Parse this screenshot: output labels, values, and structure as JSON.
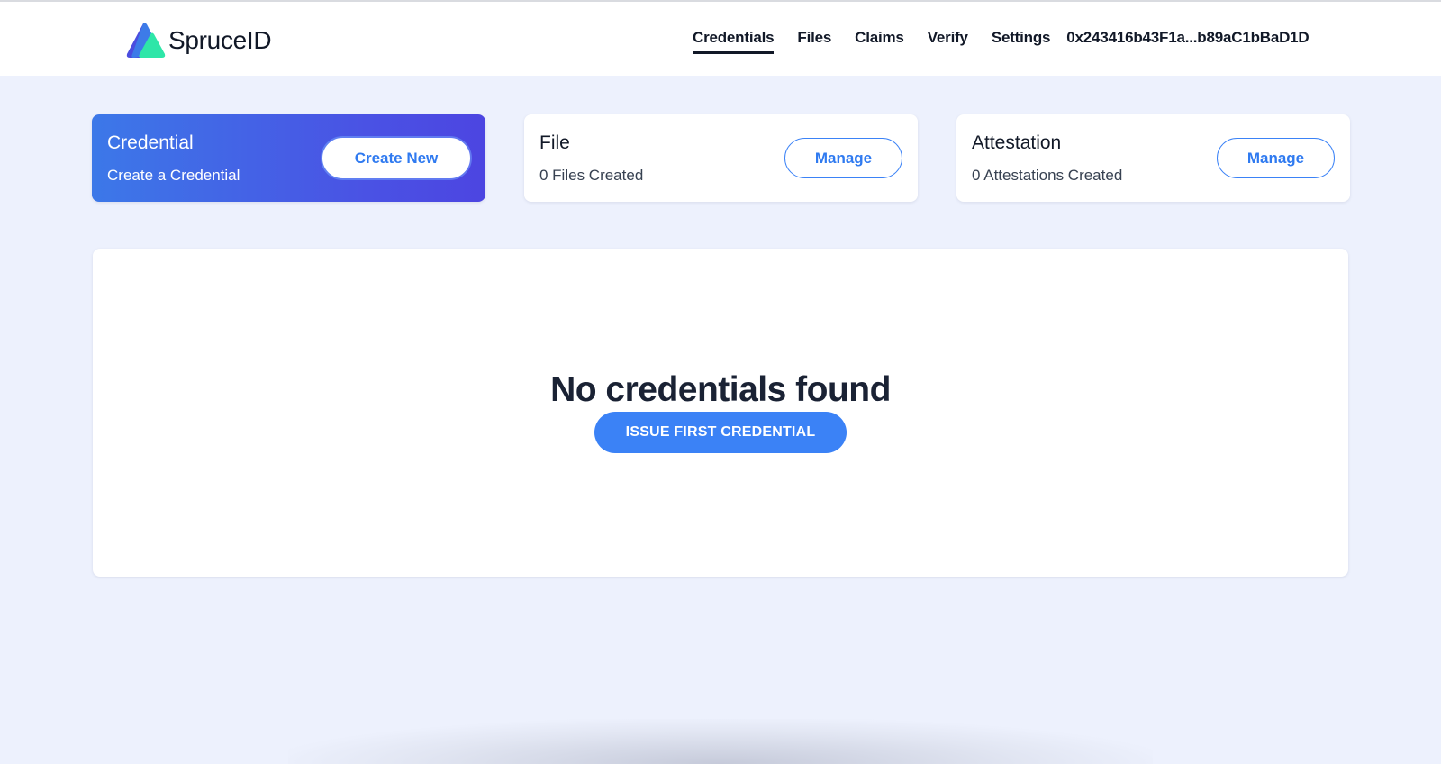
{
  "header": {
    "brand": "SpruceID",
    "nav": [
      {
        "label": "Credentials",
        "active": true
      },
      {
        "label": "Files",
        "active": false
      },
      {
        "label": "Claims",
        "active": false
      },
      {
        "label": "Verify",
        "active": false
      },
      {
        "label": "Settings",
        "active": false
      }
    ],
    "wallet_address": "0x243416b43F1a...b89aC1bBaD1D"
  },
  "cards": [
    {
      "title": "Credential",
      "subtitle": "Create a Credential",
      "button": "Create New"
    },
    {
      "title": "File",
      "subtitle": "0 Files Created",
      "button": "Manage"
    },
    {
      "title": "Attestation",
      "subtitle": "0 Attestations Created",
      "button": "Manage"
    }
  ],
  "empty_state": {
    "title": "No credentials found",
    "button": "ISSUE FIRST CREDENTIAL"
  },
  "colors": {
    "background": "#edf1fd",
    "accent": "#3b82f6",
    "gradient_start": "#3c78e8",
    "gradient_end": "#4c45e1",
    "logo_green": "#2ee6a8"
  }
}
